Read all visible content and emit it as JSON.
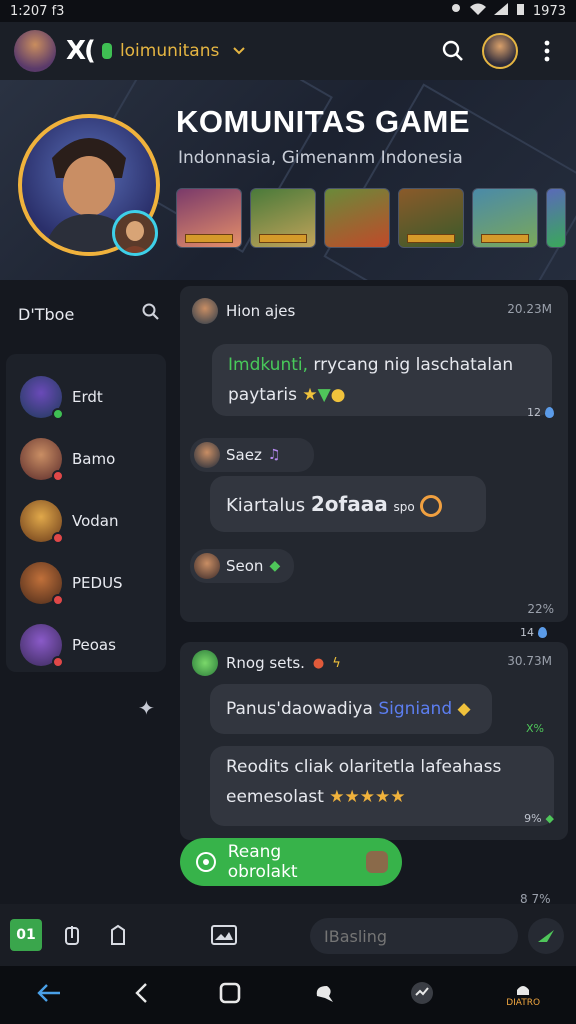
{
  "status_bar": {
    "time": "1:207 f3",
    "right_text": "1973"
  },
  "app": {
    "name_prefix": "X(",
    "channel_name": "loimunitans"
  },
  "hero": {
    "title": "KOMUNITAS GAME",
    "subtitle": "Indonnasia, Gimenanm Indonesia"
  },
  "sidebar": {
    "header_label": "D'Tboe",
    "members": [
      {
        "name": "Erdt"
      },
      {
        "name": "Bamo"
      },
      {
        "name": "Vodan"
      },
      {
        "name": "PEDUS"
      },
      {
        "name": "Peoas"
      }
    ]
  },
  "chat": {
    "thread1": {
      "sender": "Hion ajes",
      "time": "20.23M",
      "msg1_green": "Imdkunti,",
      "msg1_text": " rrycang nig laschatalan paytaris",
      "msg1_read": "12",
      "sender2": "Saez",
      "msg2_text": "Kiartalus",
      "msg2_bold": "2ofaaa",
      "msg2_suffix": "spo",
      "sender3": "Seon",
      "footer_time": "22%",
      "footer_read": "14"
    },
    "thread2": {
      "sender": "Rnog sets.",
      "time": "30.73M",
      "msg1_text": "Panus'daowadiya",
      "msg1_link": "Signiand",
      "msg1_read": "X%",
      "msg2_text": "Reodits cliak olaritetla lafeahass eemesolast",
      "msg2_read": "9%",
      "footer_time": "8 7%"
    }
  },
  "fab": {
    "label": "Reang obrolakt"
  },
  "input": {
    "placeholder": "IBasling"
  },
  "bottom_bar": {
    "tab1": "01"
  },
  "nav": {
    "label": "DIATRO"
  },
  "colors": {
    "accent_green": "#37b34a",
    "gold": "#f0b23c",
    "cyan": "#3ed0e8"
  }
}
